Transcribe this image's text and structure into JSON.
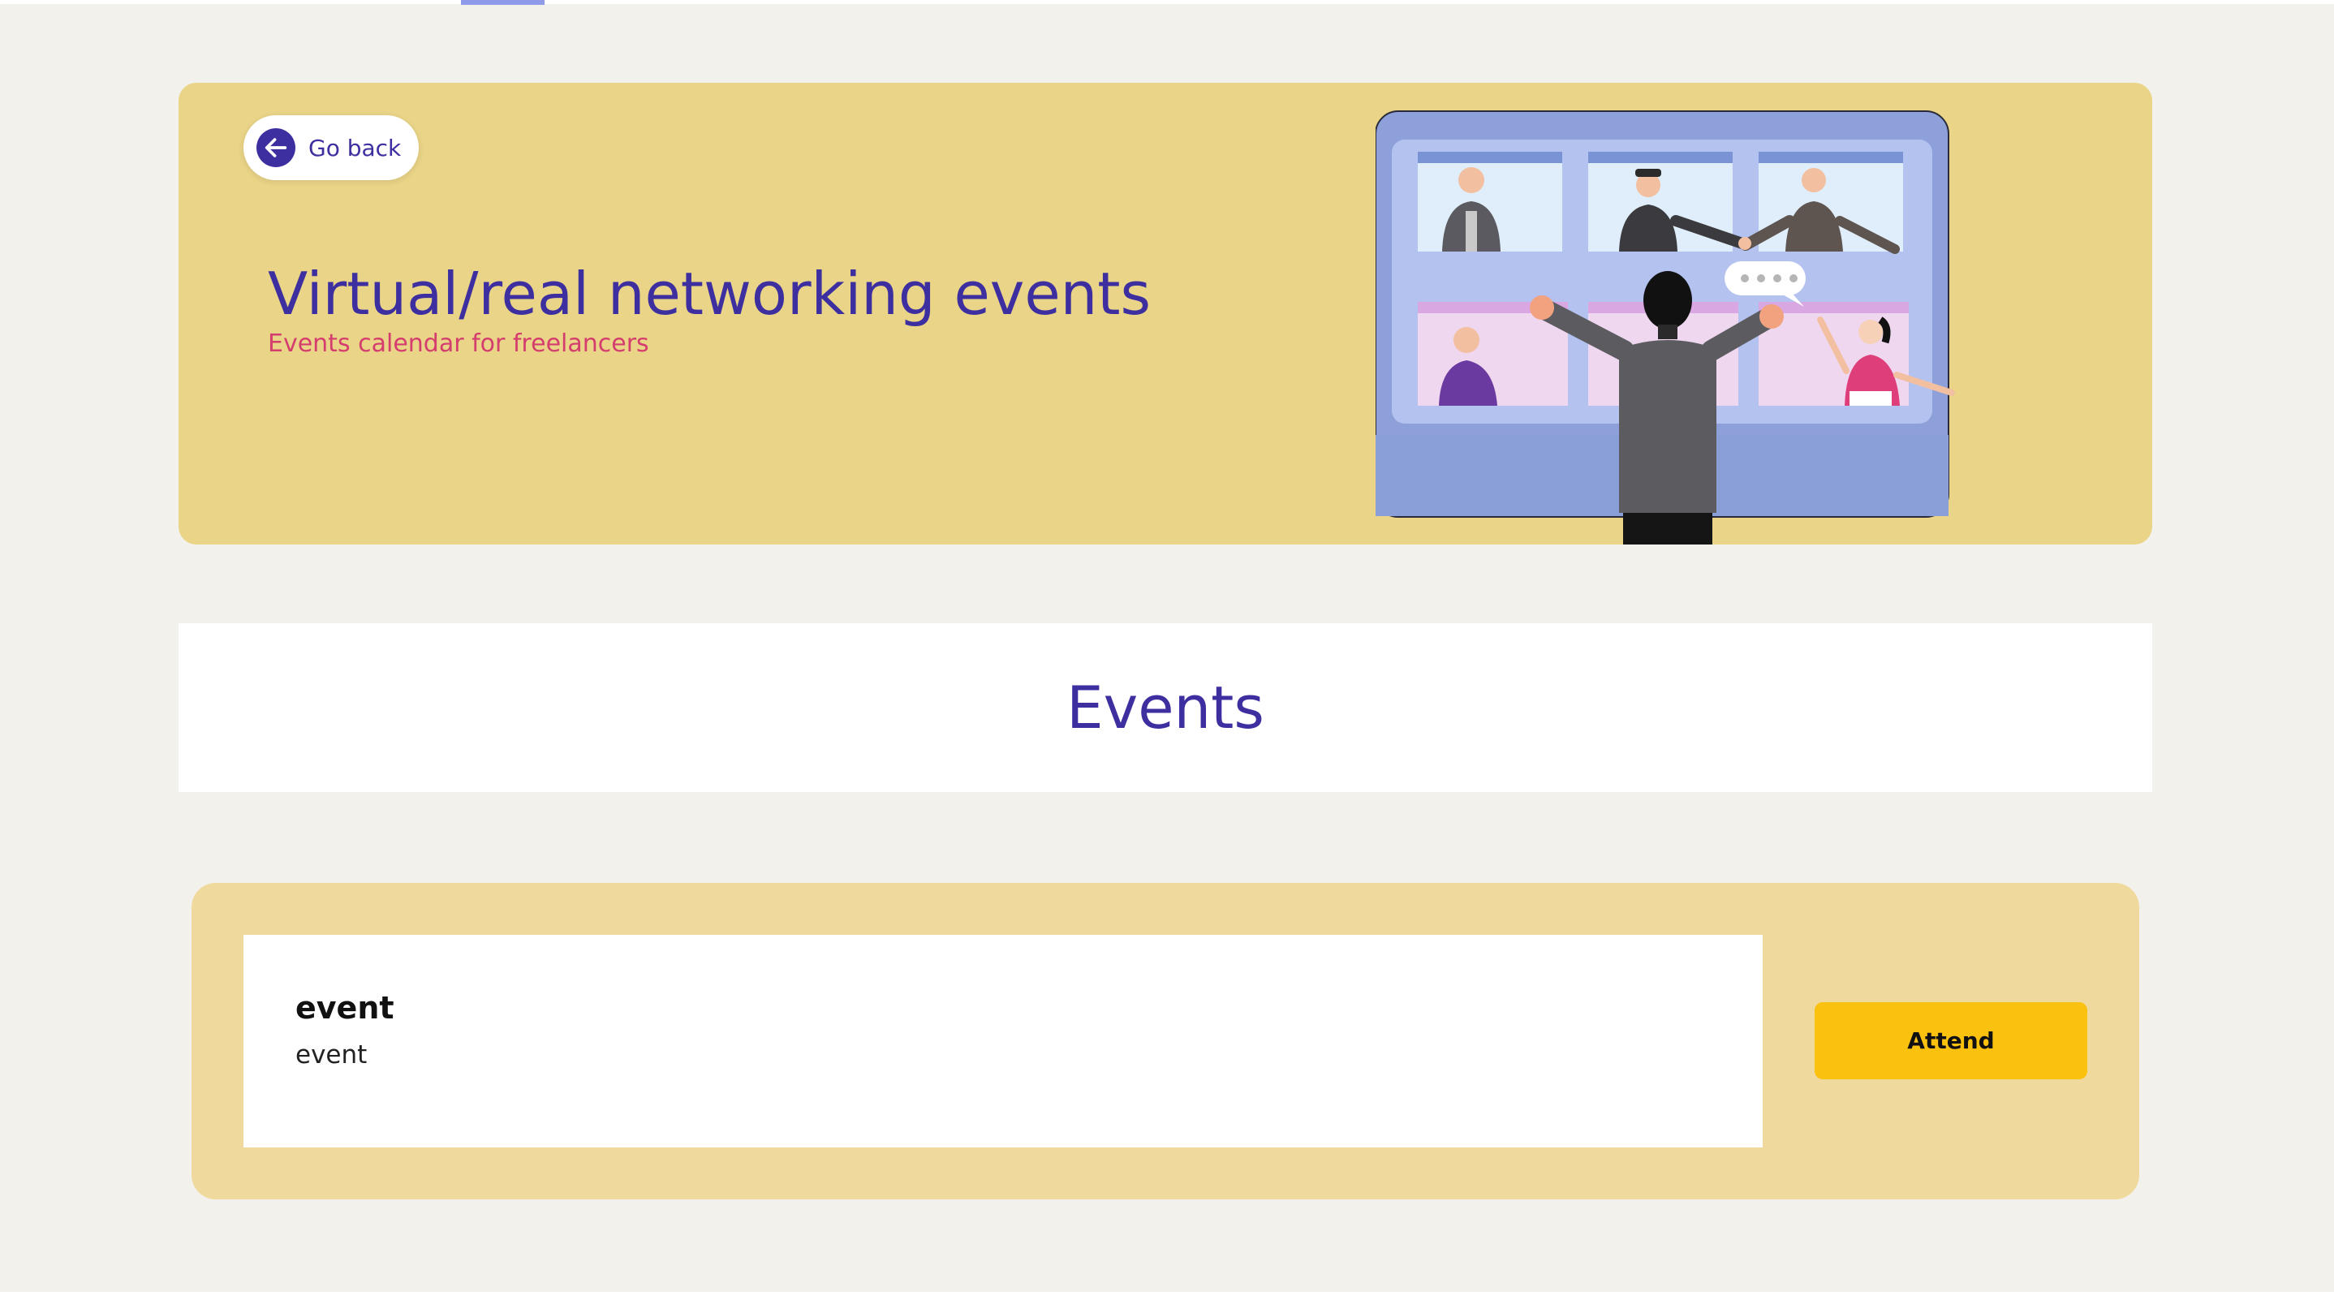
{
  "colors": {
    "background": "#f3f1ec",
    "hero_bg": "#e9d487",
    "primary": "#3d2fa0",
    "subtitle": "#d43d6e",
    "card_bg": "#f0d99c",
    "button": "#fbc10f"
  },
  "hero": {
    "back_label": "Go back",
    "back_icon": "arrow-left-icon",
    "title": "Virtual/real networking events",
    "subtitle": "Events calendar for freelancers"
  },
  "events_section": {
    "heading": "Events"
  },
  "events": [
    {
      "title": "event",
      "description": "event",
      "action_label": "Attend"
    }
  ]
}
